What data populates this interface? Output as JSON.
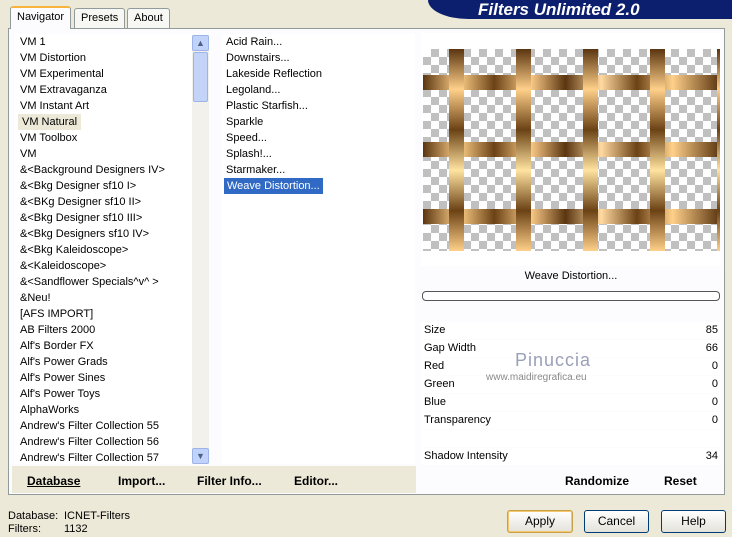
{
  "banner": "Filters Unlimited 2.0",
  "tabs": [
    "Navigator",
    "Presets",
    "About"
  ],
  "categories": [
    "VM 1",
    "VM Distortion",
    "VM Experimental",
    "VM Extravaganza",
    "VM Instant Art",
    "VM Natural",
    "VM Toolbox",
    "VM",
    "&<Background Designers IV>",
    "&<Bkg Designer sf10 I>",
    "&<BKg Designer sf10 II>",
    "&<Bkg Designer sf10 III>",
    "&<Bkg Designers sf10 IV>",
    "&<Bkg Kaleidoscope>",
    "&<Kaleidoscope>",
    "&<Sandflower Specials^v^ >",
    "&Neu!",
    "[AFS IMPORT]",
    "AB Filters 2000",
    "Alf's Border FX",
    "Alf's Power Grads",
    "Alf's Power Sines",
    "Alf's Power Toys",
    "AlphaWorks",
    "Andrew's Filter Collection 55",
    "Andrew's Filter Collection 56",
    "Andrew's Filter Collection 57"
  ],
  "selected_category": "VM Natural",
  "filters": [
    "Acid Rain...",
    "Downstairs...",
    "Lakeside Reflection",
    "Legoland...",
    "Plastic Starfish...",
    "Sparkle",
    "Speed...",
    "Splash!...",
    "Starmaker...",
    "Weave Distortion..."
  ],
  "selected_filter": "Weave Distortion...",
  "left_buttons": {
    "database": "Database",
    "import": "Import...",
    "filter_info": "Filter Info...",
    "editor": "Editor..."
  },
  "filter_name": "Weave Distortion...",
  "params": [
    {
      "label": "Size",
      "value": "85"
    },
    {
      "label": "Gap Width",
      "value": "66"
    },
    {
      "label": "Red",
      "value": "0"
    },
    {
      "label": "Green",
      "value": "0"
    },
    {
      "label": "Blue",
      "value": "0"
    },
    {
      "label": "Transparency",
      "value": "0"
    },
    {
      "label": "",
      "value": ""
    },
    {
      "label": "Shadow Intensity",
      "value": "34"
    }
  ],
  "watermark": {
    "name": "Pinuccia",
    "url": "www.maidiregrafica.eu"
  },
  "right_buttons": {
    "randomize": "Randomize",
    "reset": "Reset"
  },
  "status": {
    "database_label": "Database:",
    "database_value": "ICNET-Filters",
    "filters_label": "Filters:",
    "filters_value": "1132"
  },
  "dialog_buttons": {
    "apply": "Apply",
    "cancel": "Cancel",
    "help": "Help"
  }
}
